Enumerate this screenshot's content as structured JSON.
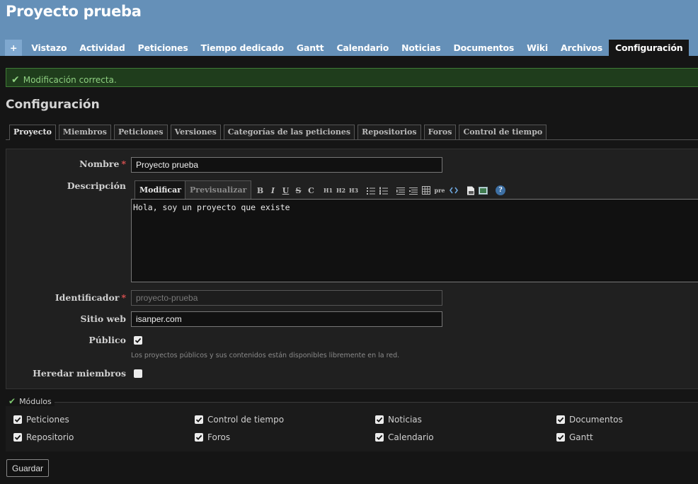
{
  "header": {
    "project_title": "Proyecto prueba",
    "menu": {
      "new": "+",
      "items": [
        "Vistazo",
        "Actividad",
        "Peticiones",
        "Tiempo dedicado",
        "Gantt",
        "Calendario",
        "Noticias",
        "Documentos",
        "Wiki",
        "Archivos"
      ],
      "selected": "Configuración"
    }
  },
  "flash": {
    "message": "Modificación correcta."
  },
  "page_title": "Configuración",
  "tabs": [
    "Proyecto",
    "Miembros",
    "Peticiones",
    "Versiones",
    "Categorías de las peticiones",
    "Repositorios",
    "Foros",
    "Control de tiempo"
  ],
  "form": {
    "name": {
      "label": "Nombre",
      "required": "*",
      "value": "Proyecto prueba"
    },
    "description": {
      "label": "Descripción",
      "tab_edit": "Modificar",
      "tab_preview": "Previsualizar",
      "toolbar": {
        "bold": "B",
        "italic": "I",
        "underline": "U",
        "strike": "S",
        "code": "C",
        "h1": "H1",
        "h2": "H2",
        "h3": "H3",
        "pre": "pre"
      },
      "value": "Hola, soy un proyecto que existe"
    },
    "identifier": {
      "label": "Identificador",
      "required": "*",
      "value": "proyecto-prueba"
    },
    "homepage": {
      "label": "Sitio web",
      "value": "isanper.com"
    },
    "public": {
      "label": "Público",
      "checked": true,
      "hint": "Los proyectos públicos y sus contenidos están disponibles libremente en la red."
    },
    "inherit_members": {
      "label": "Heredar miembros",
      "checked": false
    }
  },
  "modules": {
    "legend": "Módulos",
    "row1": [
      "Peticiones",
      "Control de tiempo",
      "Noticias",
      "Documentos"
    ],
    "row2": [
      "Repositorio",
      "Foros",
      "Calendario",
      "Gantt"
    ]
  },
  "save_label": "Guardar",
  "colors": {
    "header": "#6590b8",
    "background": "#151515",
    "flash_border": "#3f7b36",
    "required": "#e05252"
  }
}
